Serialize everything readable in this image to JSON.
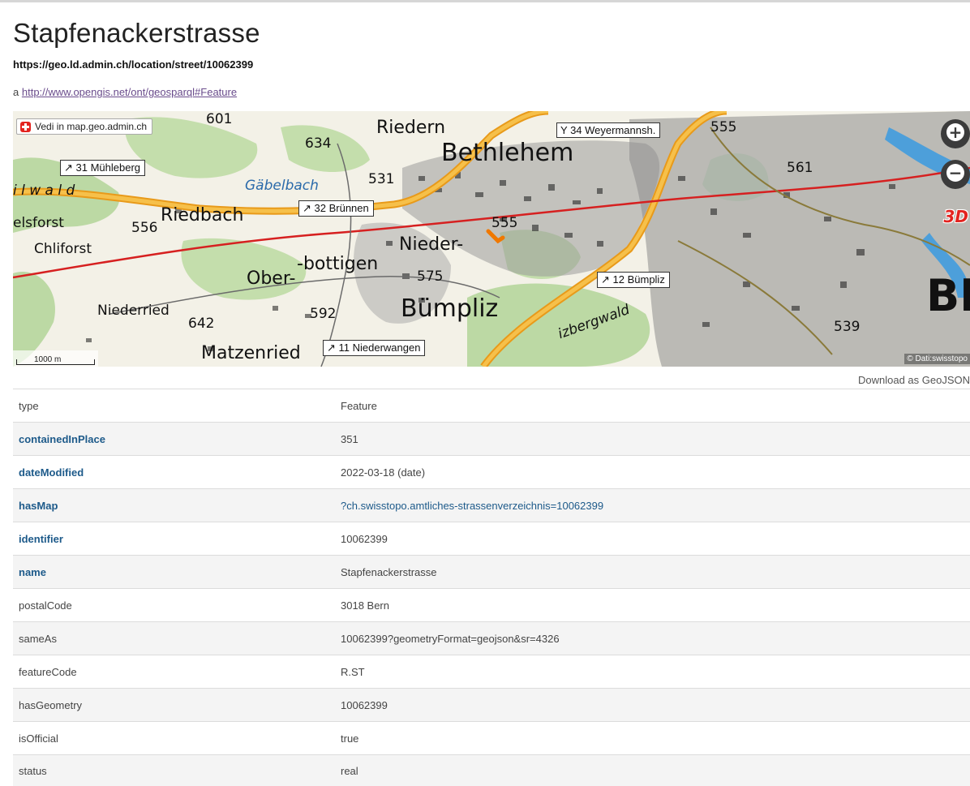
{
  "page": {
    "title": "Stapfenackerstrasse",
    "uri": "https://geo.ld.admin.ch/location/street/10062399",
    "type_prefix": "a",
    "type_link": "http://www.opengis.net/ont/geosparql#Feature"
  },
  "map": {
    "open_link_label": "Vedi in map.geo.admin.ch",
    "zoom_in_icon": "plus-icon",
    "zoom_out_icon": "minus-icon",
    "three_d_label": "3D",
    "scale_label": "1000 m",
    "attribution": "© Dati:swisstopo",
    "towns": [
      "Riedern",
      "Bethlehem",
      "Riedbach",
      "Nieder-",
      "-bottigen",
      "Ober-",
      "Bümpliz",
      "Niederried",
      "Matzenried",
      "Chliforst",
      "elsforst",
      "i l w a l d",
      "Gäbelbach",
      "izbergwald",
      "BE"
    ],
    "heights": [
      "601",
      "634",
      "531",
      "556",
      "555",
      "575",
      "592",
      "642",
      "539",
      "561",
      "555"
    ],
    "exits": [
      "31 Mühleberg",
      "32 Brünnen",
      "34 Weyermannsh.",
      "12 Bümpliz",
      "11 Niederwangen"
    ],
    "colors": {
      "motorway": "#f0a020",
      "railway": "#d62020",
      "forest": "#bcd9a4",
      "buildings": "#1a1a1a",
      "water": "#3a9ae0",
      "marker": "#f07800"
    }
  },
  "download_label": "Download as GeoJSON",
  "properties": [
    {
      "key": "type",
      "value": "Feature"
    },
    {
      "key": "containedInPlace",
      "value": "351"
    },
    {
      "key": "dateModified",
      "value": "2022-03-18 (date)"
    },
    {
      "key": "hasMap",
      "value": "?ch.swisstopo.amtliches-strassenverzeichnis=10062399"
    },
    {
      "key": "identifier",
      "value": "10062399"
    },
    {
      "key": "name",
      "value": "Stapfenackerstrasse"
    },
    {
      "key": "postalCode",
      "value": "3018 Bern"
    },
    {
      "key": "sameAs",
      "value": "10062399?geometryFormat=geojson&sr=4326"
    },
    {
      "key": "featureCode",
      "value": "R.ST"
    },
    {
      "key": "hasGeometry",
      "value": "10062399"
    },
    {
      "key": "isOfficial",
      "value": "true"
    },
    {
      "key": "status",
      "value": "real"
    }
  ]
}
